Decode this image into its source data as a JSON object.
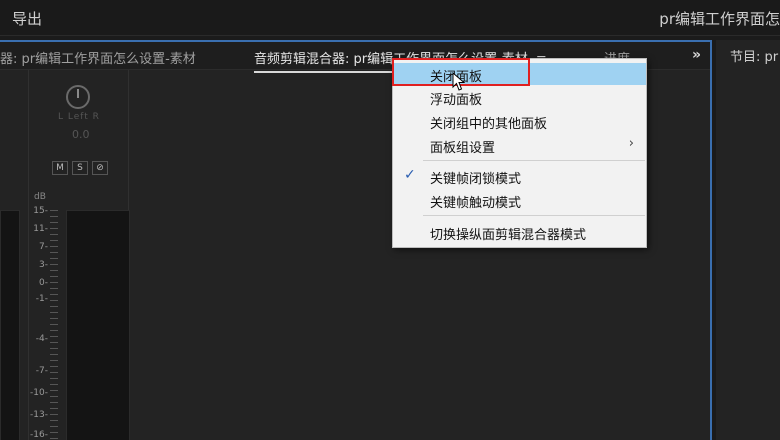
{
  "topbar": {
    "export_label": "导出",
    "window_title": "pr编辑工作界面怎"
  },
  "tabs": {
    "tab1": "器: pr编辑工作界面怎么设置-素材",
    "tab2": "音频剪辑混合器: pr编辑工作界面怎么设置-素材",
    "tab2_menu_icon": "≡",
    "tab3": "进度",
    "more": "»"
  },
  "right_panel": {
    "tab": "节目: pr"
  },
  "mixer": {
    "lr": "L  Left  R",
    "pan_value": "0.0",
    "buttons": [
      "M",
      "S",
      "⊘"
    ],
    "db_label": "dB",
    "ticks": [
      "15-",
      "11-",
      "7-",
      "3-",
      "0-",
      "-1-",
      "-4-",
      "-7-",
      "-10-",
      "-13-",
      "-16-"
    ]
  },
  "context_menu": {
    "items": [
      {
        "label": "关闭面板",
        "highlighted": true
      },
      {
        "label": "浮动面板"
      },
      {
        "label": "关闭组中的其他面板"
      },
      {
        "label": "面板组设置",
        "submenu": true
      },
      {
        "label": "关键帧闭锁模式",
        "checked": true
      },
      {
        "label": "关键帧触动模式"
      },
      {
        "label": "切换操纵面剪辑混合器模式"
      }
    ],
    "submenu_arrow": "›",
    "check_glyph": "✓"
  },
  "colors": {
    "highlight": "#9fd2f2",
    "annotation": "#e02020",
    "panel_border": "#3a6fb0"
  }
}
